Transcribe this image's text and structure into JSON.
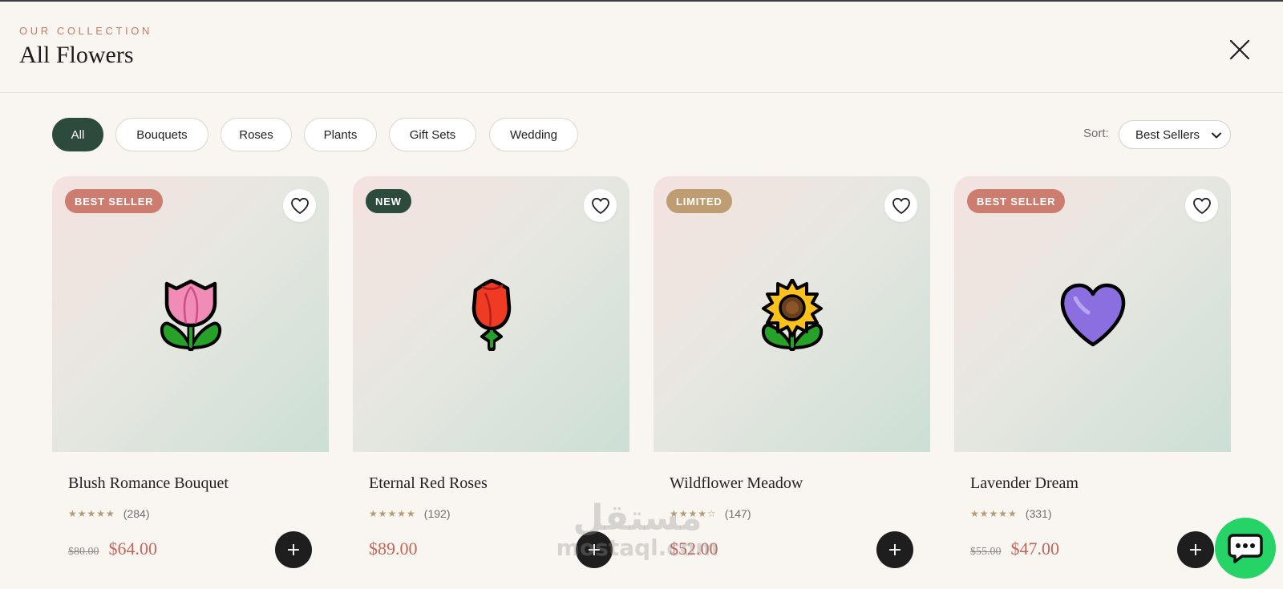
{
  "header": {
    "eyebrow": "OUR COLLECTION",
    "title": "All Flowers"
  },
  "filters": [
    {
      "label": "All",
      "active": true
    },
    {
      "label": "Bouquets",
      "active": false
    },
    {
      "label": "Roses",
      "active": false
    },
    {
      "label": "Plants",
      "active": false
    },
    {
      "label": "Gift Sets",
      "active": false
    },
    {
      "label": "Wedding",
      "active": false
    }
  ],
  "sort": {
    "label": "Sort:",
    "selected": "Best Sellers"
  },
  "products": [
    {
      "badge": "BEST SELLER",
      "badge_color": "#cc7d70",
      "icon": "tulip-icon",
      "name": "Blush Romance Bouquet",
      "stars": "★★★★★",
      "rating": 5,
      "reviews": "(284)",
      "old_price": "$80.00",
      "price": "$64.00"
    },
    {
      "badge": "NEW",
      "badge_color": "#2d4b3d",
      "icon": "rose-icon",
      "name": "Eternal Red Roses",
      "stars": "★★★★★",
      "rating": 5,
      "reviews": "(192)",
      "old_price": "",
      "price": "$89.00"
    },
    {
      "badge": "LIMITED",
      "badge_color": "#bf9d72",
      "icon": "sunflower-icon",
      "name": "Wildflower Meadow",
      "stars": "★★★★☆",
      "rating": 4,
      "reviews": "(147)",
      "old_price": "",
      "price": "$52.00"
    },
    {
      "badge": "BEST SELLER",
      "badge_color": "#cc7d70",
      "icon": "purple-heart-icon",
      "name": "Lavender Dream",
      "stars": "★★★★★",
      "rating": 5,
      "reviews": "(331)",
      "old_price": "$55.00",
      "price": "$47.00"
    }
  ],
  "add_label": "+",
  "watermark": {
    "arabic": "مستقل",
    "latin": "mostaql.com"
  },
  "colors": {
    "background": "#f9f6f1",
    "accent_green": "#2d4b3d",
    "price": "#c5655a",
    "chat": "#25d366"
  }
}
